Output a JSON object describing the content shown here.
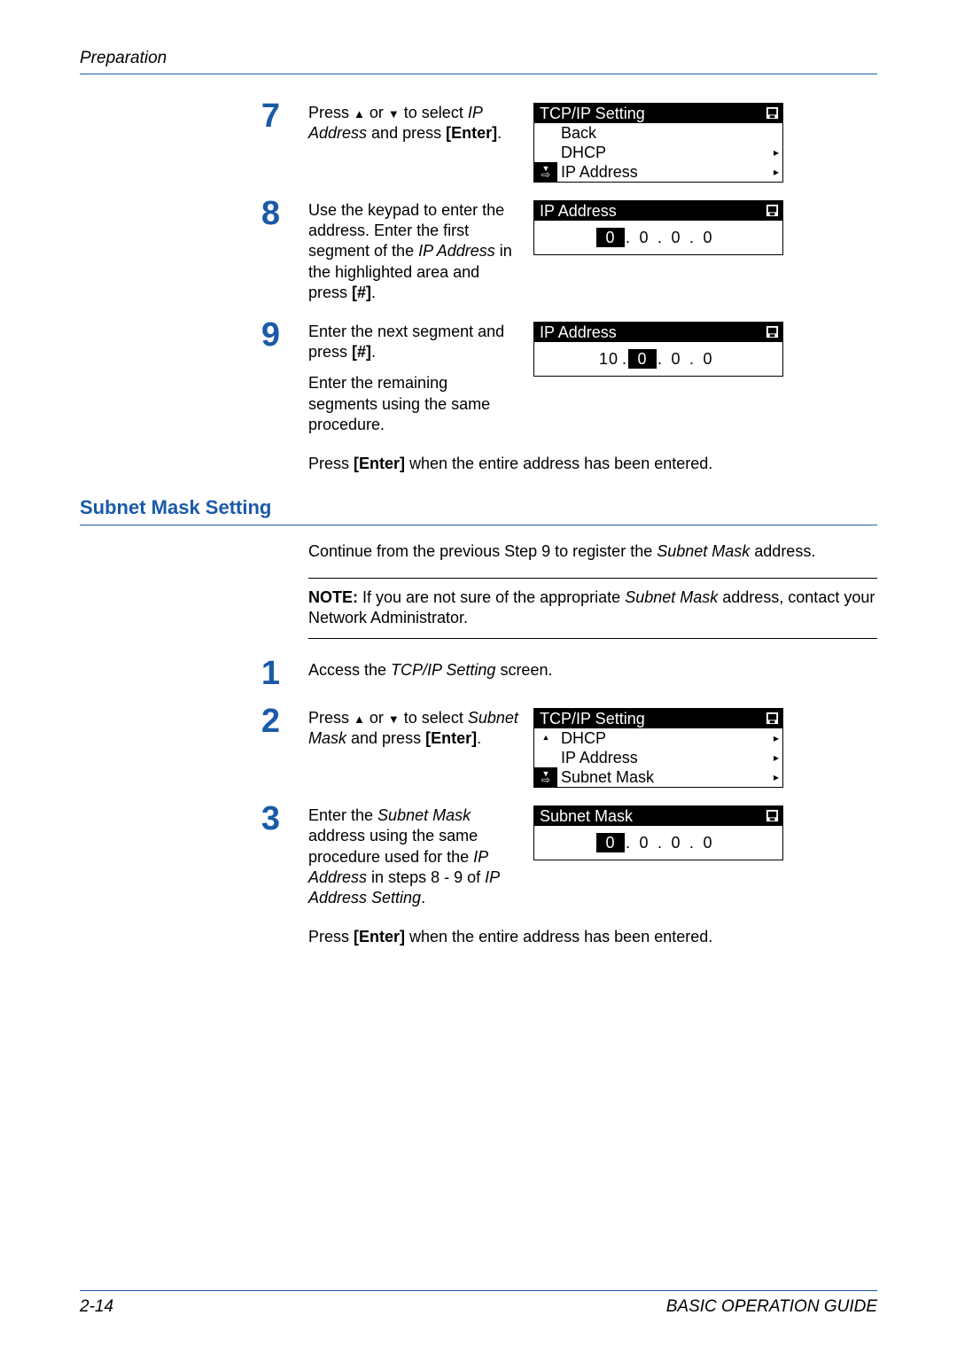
{
  "header": {
    "left": "Preparation",
    "right": ""
  },
  "footer": {
    "left": "2-14",
    "right": "BASIC OPERATION GUIDE"
  },
  "steps_a": {
    "s7": {
      "num": "7",
      "text_a": "Press ",
      "text_b": " or ",
      "text_c": " to select ",
      "ital1": "IP Address",
      "text_d": " and press ",
      "bold1": "[Enter]",
      "text_e": ".",
      "panel": {
        "title": "TCP/IP Setting",
        "rows": [
          {
            "label": "Back",
            "sub": false,
            "sel": false
          },
          {
            "label": "DHCP",
            "sub": true,
            "sel": false
          },
          {
            "label": "IP Address",
            "sub": true,
            "sel": true
          }
        ]
      }
    },
    "s8": {
      "num": "8",
      "t1": "Use the keypad to enter the address. Enter the first segment of the ",
      "i1": "IP Address",
      "t2": " in the highlighted area and press ",
      "b1": "[#]",
      "t3": ".",
      "panel": {
        "title": "IP Address",
        "segs": [
          "0",
          "0",
          "0",
          "0"
        ],
        "selIndex": 0
      }
    },
    "s9": {
      "num": "9",
      "t1": "Enter the next segment and press ",
      "b1": "[#]",
      "t2": ".",
      "t3": "Enter the remaining segments using the same procedure.",
      "after": "Press ",
      "after_b": "[Enter]",
      "after2": " when the entire address has been entered.",
      "panel": {
        "title": "IP Address",
        "segs": [
          "10",
          "0",
          "0",
          "0"
        ],
        "selIndex": 1
      }
    }
  },
  "section2": {
    "title": "Subnet Mask Setting",
    "intro_a": "Continue from the previous Step 9 to register the ",
    "intro_i": "Subnet Mask",
    "intro_b": " address.",
    "note_b": "NOTE:",
    "note_t1": " If you are not sure of the appropriate ",
    "note_i": "Subnet Mask",
    "note_t2": " address, contact your Network Administrator.",
    "s1": {
      "num": "1",
      "t1": "Access the ",
      "i1": "TCP/IP Setting",
      "t2": " screen."
    },
    "s2": {
      "num": "2",
      "t1": "Press ",
      "t2": " or ",
      "t3": " to select ",
      "i1": "Subnet Mask",
      "t4": " and press ",
      "b1": "[Enter]",
      "t5": ".",
      "panel": {
        "title": "TCP/IP Setting",
        "rows": [
          {
            "label": "DHCP",
            "sub": true,
            "sel": false,
            "up": true
          },
          {
            "label": "IP Address",
            "sub": true,
            "sel": false
          },
          {
            "label": "Subnet Mask",
            "sub": true,
            "sel": true
          }
        ]
      }
    },
    "s3": {
      "num": "3",
      "t1": "Enter the ",
      "i1": "Subnet Mask",
      "t2": " address using the same procedure used for the ",
      "i2": "IP Address",
      "t3": " in steps 8 - 9 of ",
      "i3": "IP Address Setting",
      "t4": ".",
      "after1": "Press ",
      "after_b": "[Enter]",
      "after2": " when the entire address has been entered.",
      "panel": {
        "title": "Subnet Mask",
        "segs": [
          "0",
          "0",
          "0",
          "0"
        ],
        "selIndex": 0
      }
    }
  }
}
